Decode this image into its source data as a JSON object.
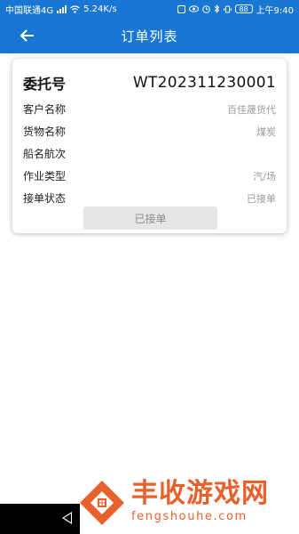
{
  "status_bar": {
    "carrier": "中国联通4G",
    "net_speed": "5.24K/s",
    "battery": "88",
    "time": "上午9:40"
  },
  "app_bar": {
    "back_icon": "arrow-left-icon",
    "title": "订单列表"
  },
  "order_card": {
    "header_label": "委托号",
    "order_number": "WT202311230001",
    "fields": [
      {
        "label": "客户名称",
        "value": "百佳晟货代"
      },
      {
        "label": "货物名称",
        "value": "煤炭"
      },
      {
        "label": "船名航次",
        "value": ""
      },
      {
        "label": "作业类型",
        "value": "汽/场"
      },
      {
        "label": "接单状态",
        "value": "已接单"
      }
    ],
    "action_button": "已接单"
  },
  "watermark": {
    "name": "丰收游戏网",
    "domain": "fengshouhe.com"
  },
  "colors": {
    "primary": "#1976D2",
    "watermark": "#e8612c",
    "button_bg": "#e6e6e6",
    "value_text": "#9a9a9a"
  }
}
